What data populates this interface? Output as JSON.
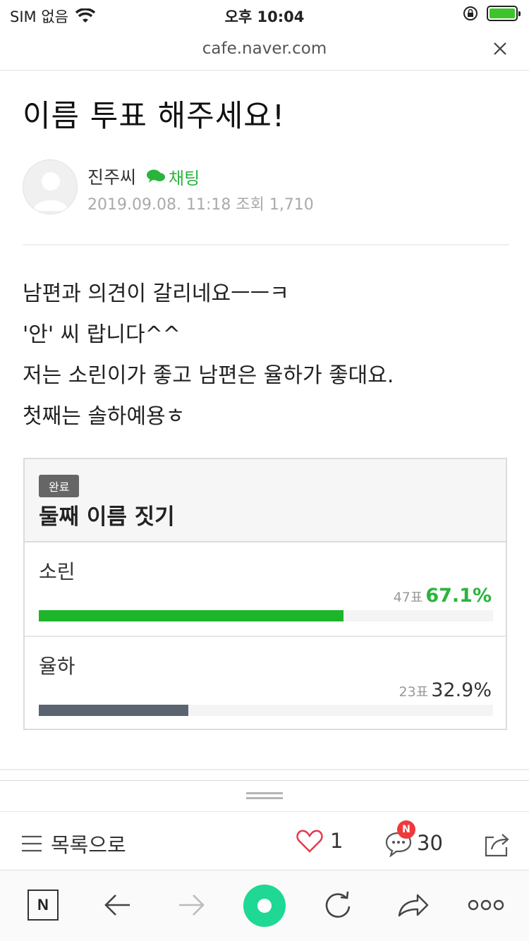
{
  "status_bar": {
    "carrier": "SIM 없음",
    "time": "오후 10:04"
  },
  "url_bar": {
    "url": "cafe.naver.com"
  },
  "post": {
    "title": "이름 투표 해주세요!",
    "author": "진주씨",
    "chat_label": "채팅",
    "meta": "2019.09.08. 11:18 조회 1,710",
    "body_lines": [
      "남편과 의견이 갈리네요ㅡㅡㅋ",
      "'안' 씨 랍니다^^",
      "저는 소린이가 좋고 남편은 율하가 좋대요.",
      "첫째는 솔하예용ㅎ"
    ]
  },
  "poll": {
    "badge": "완료",
    "title": "둘째 이름 짓기",
    "options": [
      {
        "label": "소린",
        "votes": "47표",
        "percent": "67.1%",
        "fraction": 0.671,
        "color": "#1db52a"
      },
      {
        "label": "율하",
        "votes": "23표",
        "percent": "32.9%",
        "fraction": 0.329,
        "color": "#5b6470"
      }
    ]
  },
  "action_bar": {
    "list_label": "목록으로",
    "likes": "1",
    "comments": "30",
    "new_badge": "N"
  },
  "toolbar": {
    "naver_label": "N"
  },
  "colors": {
    "accent_green": "#2bb43c",
    "badge_red": "#f0393d",
    "toolbar_green": "#1ed893"
  }
}
